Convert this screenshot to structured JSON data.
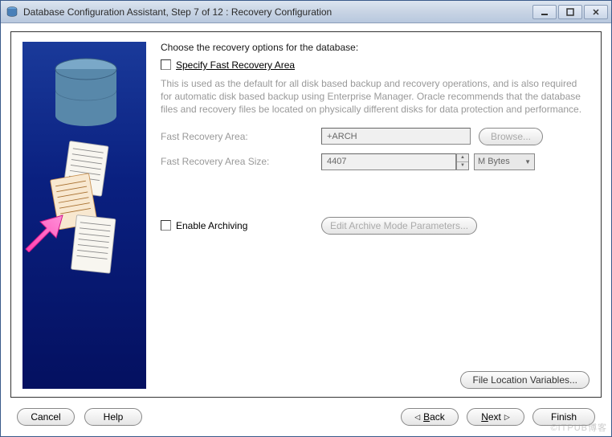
{
  "window": {
    "title": "Database Configuration Assistant, Step 7 of 12 : Recovery Configuration"
  },
  "main": {
    "heading": "Choose the recovery options for the database:",
    "specify_label": "Specify Fast Recovery Area",
    "desc": "This is used as the default for all disk based backup and recovery operations, and is also required for automatic disk based backup using Enterprise Manager. Oracle recommends that the database files and recovery files be located on physically different disks for data protection and performance.",
    "fra_label": "Fast Recovery Area:",
    "fra_value": "+ARCH",
    "browse": "Browse...",
    "fra_size_label": "Fast Recovery Area Size:",
    "fra_size_value": "4407",
    "fra_size_unit": "M Bytes",
    "enable_arch_label": "Enable Archiving",
    "edit_arch_btn": "Edit Archive Mode Parameters...",
    "flv_btn": "File Location Variables..."
  },
  "footer": {
    "cancel": "Cancel",
    "help": "Help",
    "back": "Back",
    "next": "Next",
    "finish": "Finish"
  },
  "watermark": "©ITPUB博客"
}
